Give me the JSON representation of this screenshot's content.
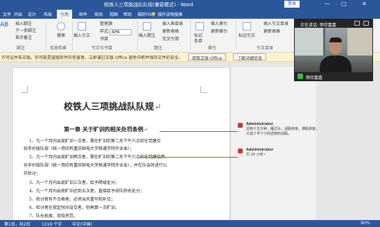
{
  "window": {
    "title": "校铁人三项挑战队队规(兼容模式) - Word",
    "login_label": "登录",
    "minimize": "—",
    "restore": "▢",
    "close": "✕"
  },
  "tabs": [
    {
      "label": "文件"
    },
    {
      "label": "开始"
    },
    {
      "label": "设计"
    },
    {
      "label": "布局"
    },
    {
      "label": "引用"
    },
    {
      "label": "邮件"
    },
    {
      "label": "审阅"
    },
    {
      "label": "视图"
    },
    {
      "label": "帮助"
    },
    {
      "label": "福昕PDF"
    }
  ],
  "tell_me": "操作说明搜索",
  "ribbon": {
    "toc_partial": "AB",
    "insert_footnote": "插入脚注",
    "next_footnote": "下一条脚注",
    "show_notes": "显示备注",
    "group_footnotes": "脚注",
    "search": "搜索",
    "group_research": "信息检索",
    "insert_citation": "插入引文",
    "manage_sources": "管理源",
    "style_label": "样式:",
    "style_value": "APA",
    "bibliography": "书目",
    "group_citations": "引文与书目",
    "insert_caption": "插入题注",
    "insert_table_figures": "插入表目录",
    "update_table": "更新表格",
    "cross_reference": "交叉引用",
    "group_captions": "题注",
    "mark_entry": "标记条目",
    "insert_index": "插入索引",
    "update_index": "更新索引",
    "group_index": "索引",
    "mark_citation": "标记引文",
    "insert_toa": "插入引文目录",
    "update_toa": "更新表格",
    "group_toa": "引文目录"
  },
  "message_bar": {
    "text": "许可证并非正版。你可能是盗版软件的受害者。立即通过正版 Office 避免中断并保持文件的安全。",
    "button_genuine": "获取正版 Office",
    "button_learn": "了解详细信息"
  },
  "document": {
    "title": "校铁人三项挑战队队规",
    "chapter": "第一章   关于旷训的相关处罚条例",
    "return_mark": "↵",
    "paragraphs": [
      "1、凡一个月内出现旷训一次者，需在旷训的第二天下午六点前在党建交",
      "份手抄版队规（统一用印有重庆邮电大学移通学院作业本）；",
      "2、凡一个月内出现旷训两次者，需在旷训的第二天下午六点前在党建交两",
      "份手抄版队规（统一用印有重庆邮电大学移通学院作业本），并在队会时进行公",
      "开检讨；",
      "3、凡一个月内出现旷训三次者，给予降级处分；",
      "4、凡一个月内出现旷训达到五次者，直接给予校队除名处分；",
      "5、检讨者有不合格者，必须当天重写和补交；",
      "6、检讨者在规定时间没交者，则再算一次旷训。",
      "7、队长抵挽，双倍惩罚。"
    ]
  },
  "comments": [
    {
      "author": "Administrator",
      "lines": [
        "迟到十五分钟，睡过头，请假未批，课假未批，",
        "只请了半个小时迟到的请假。"
      ]
    },
    {
      "author": "Administrator",
      "lines": [
        "罚 24 小时~"
      ]
    }
  ],
  "meeting": {
    "speaking_label": "正在讲话: 荣欣嘉嘉",
    "participant_name": "荣欣嘉嘉"
  },
  "statusbar": {
    "page": "第1页，共2页",
    "words": "1219 个字",
    "language": "中文(中国)",
    "zoom": "90%"
  },
  "colors": {
    "brand": "#2b579a",
    "message_bar": "#fff4ce",
    "comment_marker": "#c23b3b"
  }
}
